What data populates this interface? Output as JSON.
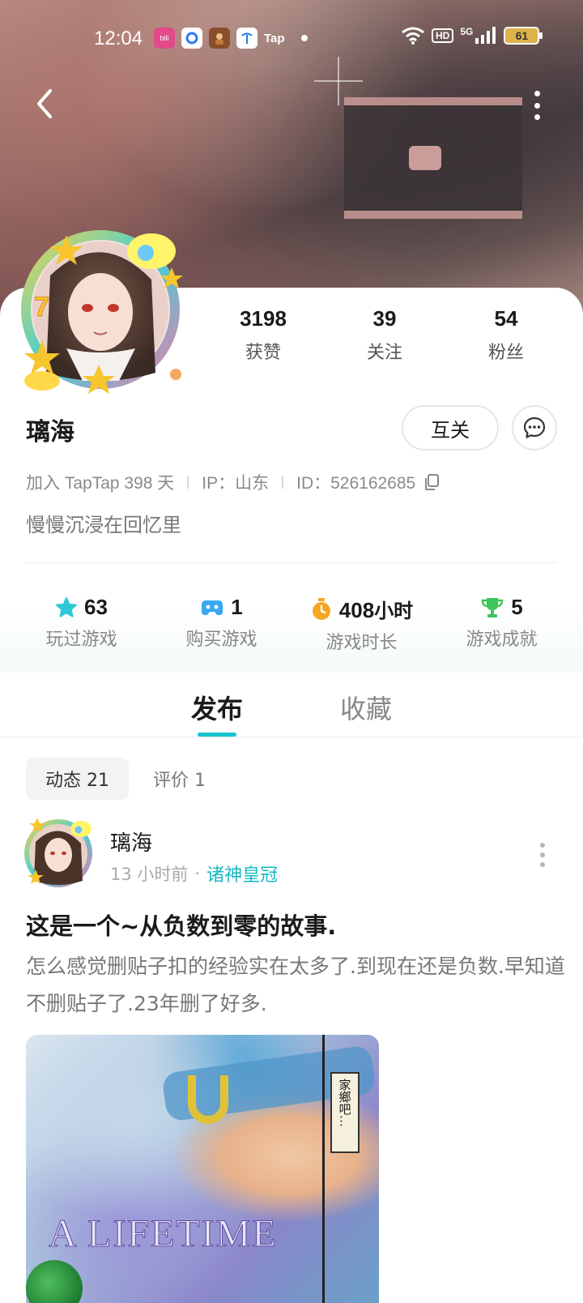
{
  "status_bar": {
    "time": "12:04",
    "apps": [
      {
        "name": "bilibili-app-icon",
        "color": "#e24a8a"
      },
      {
        "name": "qq-browser-app-icon",
        "color": "#2f7bf2"
      },
      {
        "name": "game-app-icon",
        "color": "#8a4e2a"
      },
      {
        "name": "china-telecom-app-icon",
        "color": "#1e7be3"
      }
    ],
    "tap_label": "Tap",
    "network": "5G",
    "hd_label": "HD",
    "battery": "61"
  },
  "profile": {
    "username": "璃海",
    "stats": [
      {
        "value": "3198",
        "label": "获赞"
      },
      {
        "value": "39",
        "label": "关注"
      },
      {
        "value": "54",
        "label": "粉丝"
      }
    ],
    "mutual_button": "互关",
    "joined": "加入 TapTap 398 天",
    "ip": "IP：山东",
    "id": "ID：526162685",
    "bio": "慢慢沉浸在回忆里"
  },
  "game_stats": [
    {
      "icon": "star-icon",
      "value": "63",
      "unit": "",
      "label": "玩过游戏",
      "color": "#2ec7d6"
    },
    {
      "icon": "gamepad-icon",
      "value": "1",
      "unit": "",
      "label": "购买游戏",
      "color": "#3aa8f0"
    },
    {
      "icon": "timer-icon",
      "value": "408",
      "unit": "小时",
      "label": "游戏时长",
      "color": "#f5a623"
    },
    {
      "icon": "trophy-icon",
      "value": "5",
      "unit": "",
      "label": "游戏成就",
      "color": "#3ec45a"
    }
  ],
  "tabs": {
    "publish": "发布",
    "favorites": "收藏"
  },
  "subtabs": {
    "moments": "动态 21",
    "reviews": "评价 1"
  },
  "post": {
    "author": "璃海",
    "time": "13 小时前",
    "dot": "·",
    "game": "诸神皇冠",
    "title": "这是一个~从负数到零的故事.",
    "body": "怎么感觉删贴子扣的经验实在太多了.到现在还是负数.早知道不删贴子了.23年删了好多.",
    "image_caption": "家鄉吧…",
    "image_text": "A LIFETIME"
  }
}
